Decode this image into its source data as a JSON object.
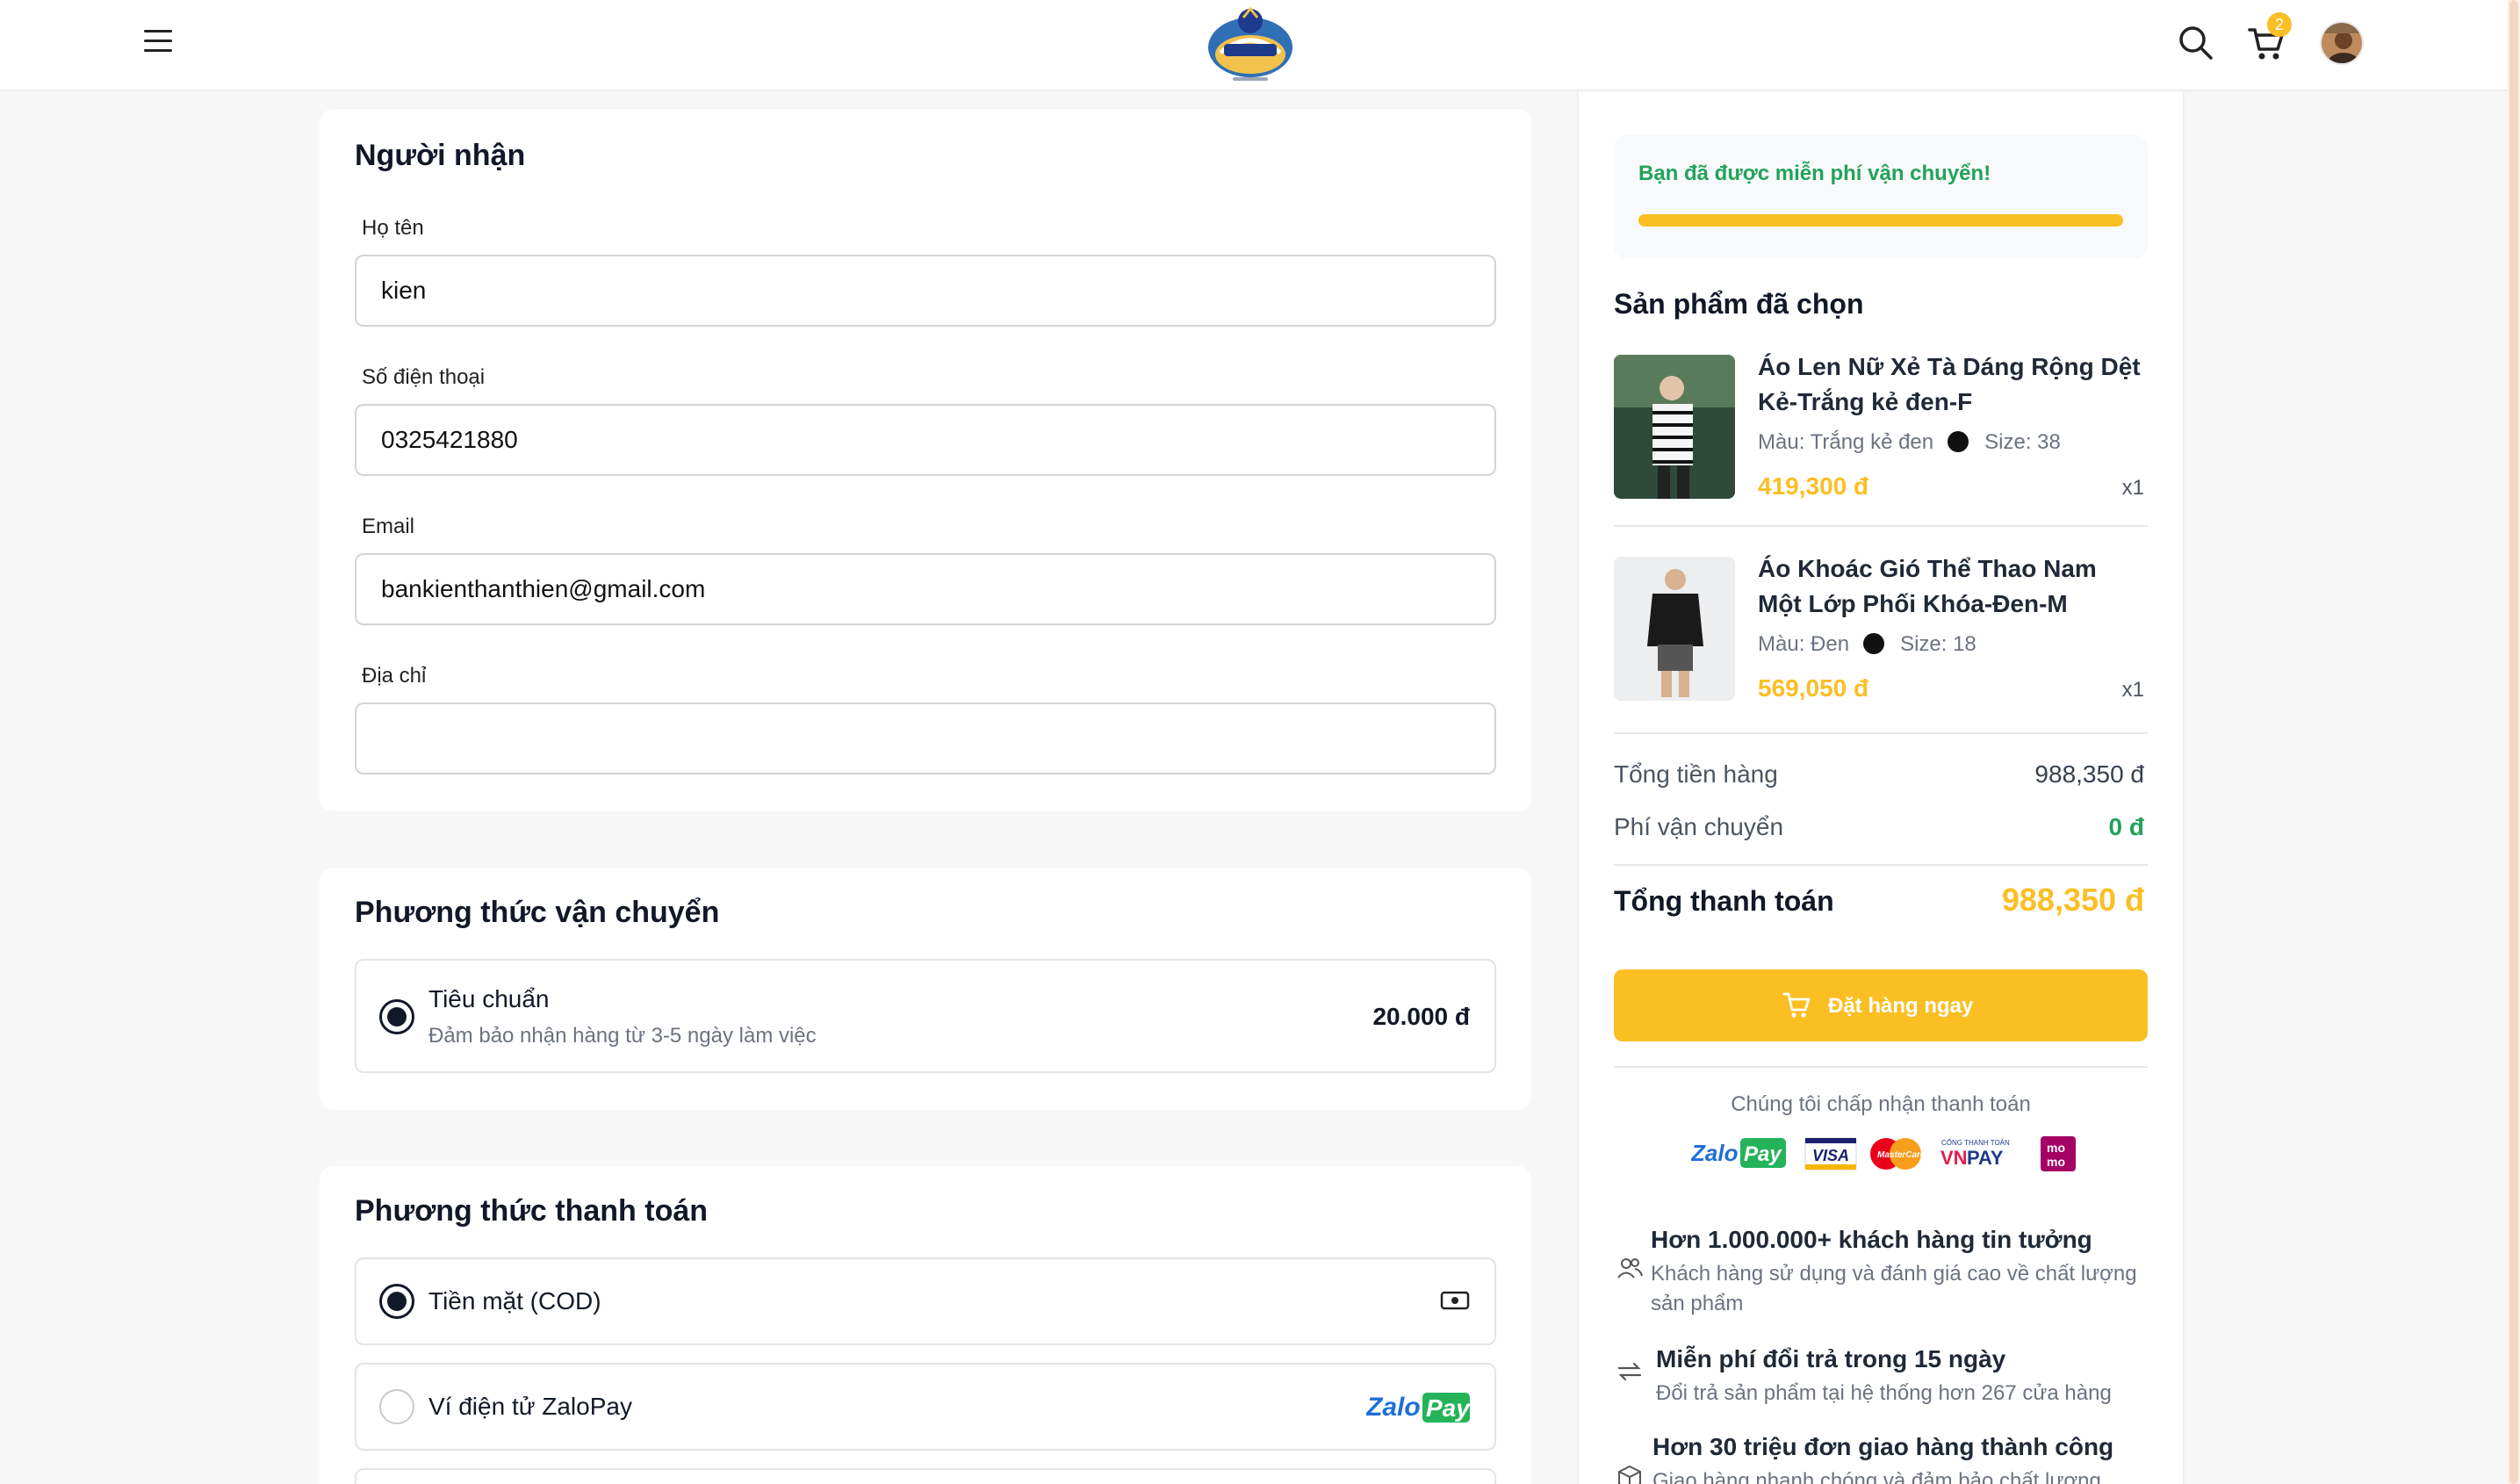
{
  "header": {
    "menu_icon": "hamburger-menu-icon",
    "logo_icon": "brand-logo",
    "search_icon": "search-icon",
    "cart_icon": "cart-icon",
    "cart_count": "2",
    "avatar": "user-avatar"
  },
  "recipient": {
    "title": "Người nhận",
    "name_label": "Họ tên",
    "name_value": "kien",
    "phone_label": "Số điện thoại",
    "phone_value": "0325421880",
    "email_label": "Email",
    "email_value": "bankienthanthien@gmail.com",
    "address_label": "Địa chỉ",
    "address_value": ""
  },
  "shipping": {
    "title": "Phương thức vận chuyển",
    "option_name": "Tiêu chuẩn",
    "option_desc": "Đảm bảo nhận hàng từ 3-5 ngày làm việc",
    "option_price": "20.000 đ",
    "selected": true
  },
  "payment": {
    "title": "Phương thức thanh toán",
    "options": [
      {
        "label": "Tiền mặt (COD)",
        "icon": "cash-icon",
        "selected": true
      },
      {
        "label": "Ví điện tử ZaloPay",
        "icon": "zalopay-logo",
        "selected": false
      }
    ]
  },
  "summary": {
    "free_shipping_msg": "Bạn đã được miễn phí vận chuyển!",
    "free_shipping_progress": 1.0,
    "products_title": "Sản phẩm đã chọn",
    "products": [
      {
        "name": "Áo Len Nữ Xẻ Tà Dáng Rộng Dệt Kẻ-Trắng kẻ đen-F",
        "color": "Màu: Trắng kẻ đen",
        "size": "Size: 38",
        "price": "419,300 đ",
        "qty": "x1"
      },
      {
        "name": "Áo Khoác Gió Thể Thao Nam Một Lớp Phối Khóa-Đen-M",
        "color": "Màu: Đen",
        "size": "Size: 18",
        "price": "569,050 đ",
        "qty": "x1"
      }
    ],
    "subtotal_label": "Tổng tiền hàng",
    "subtotal_value": "988,350 đ",
    "shipping_fee_label": "Phí vận chuyển",
    "shipping_fee_value": "0 đ",
    "total_label": "Tổng thanh toán",
    "total_value": "988,350 đ",
    "order_button": "Đặt hàng ngay",
    "accept_text": "Chúng tôi chấp nhận thanh toán",
    "payment_logos": [
      "ZaloPay",
      "VISA",
      "MasterCard",
      "VNPAY",
      "mo mo"
    ]
  },
  "trust": [
    {
      "icon": "users-icon",
      "title": "Hơn 1.000.000+ khách hàng tin tưởng",
      "desc": "Khách hàng sử dụng và đánh giá cao về chất lượng sản phẩm"
    },
    {
      "icon": "exchange-icon",
      "title": "Miễn phí đổi trả trong 15 ngày",
      "desc": "Đổi trả sản phẩm tại hệ thống hơn 267 cửa hàng"
    },
    {
      "icon": "box-icon",
      "title": "Hơn 30 triệu đơn giao hàng thành công",
      "desc": "Giao hàng nhanh chóng và đảm bảo chất lượng"
    }
  ],
  "colors": {
    "accent": "#fbbf24",
    "success": "#22a35a",
    "text": "#1f2937"
  }
}
